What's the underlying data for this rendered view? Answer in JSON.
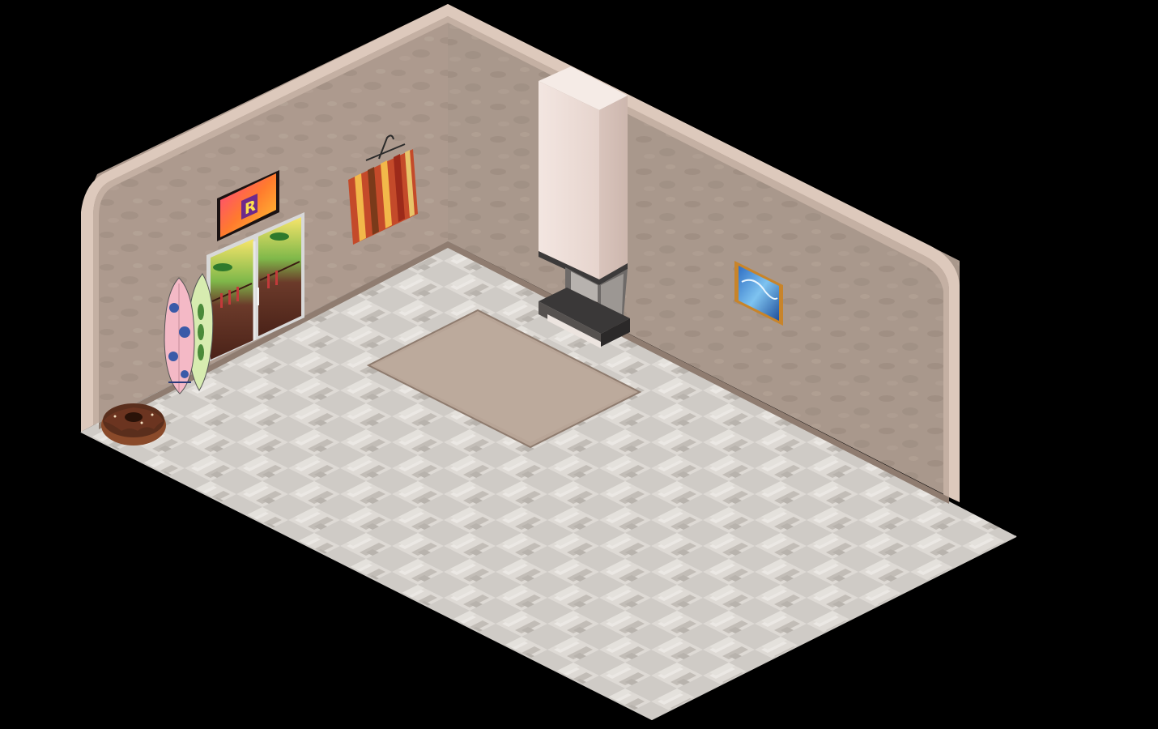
{
  "room": {
    "colors": {
      "background": "#000000",
      "wall_left": "#ad9a8e",
      "wall_right": "#a8978b",
      "wall_cap": "#ddc9bc",
      "wall_cap_shadow": "#c4b0a3",
      "floor_base": "#d4d0cb",
      "floor_tile_light": "#e6e3df",
      "floor_tile_dark": "#bdb8b2",
      "skirting": "#8f7c70",
      "rug": "#bba99b",
      "rug_border": "#8e7b6e"
    },
    "furniture": [
      {
        "id": "sunset-picture",
        "icon": "framed-sunset-letter-r"
      },
      {
        "id": "tropical-glass-door",
        "icon": "glass-door-palms"
      },
      {
        "id": "surfboard-pink",
        "icon": "surfboard-hibiscus"
      },
      {
        "id": "surfboard-green",
        "icon": "surfboard-fern"
      },
      {
        "id": "donut-pouf",
        "icon": "chocolate-donut"
      },
      {
        "id": "striped-wall-banner",
        "icon": "hanging-striped-rug"
      },
      {
        "id": "corner-fireplace",
        "icon": "chimney-fireplace"
      },
      {
        "id": "floor-rug",
        "icon": "beige-rug"
      },
      {
        "id": "wave-picture",
        "icon": "framed-wave-art"
      }
    ]
  }
}
